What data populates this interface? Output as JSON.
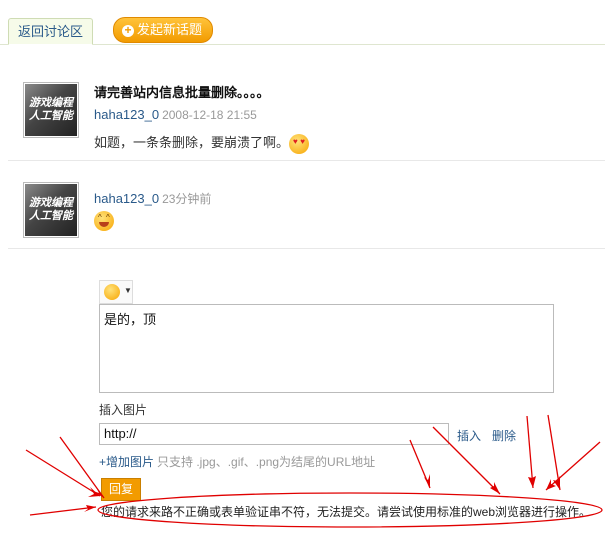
{
  "tabs": {
    "back_label": "返回讨论区",
    "new_topic_label": "发起新话题"
  },
  "posts": [
    {
      "title": "请完善站内信息批量删除。。。。",
      "user": "haha123_0",
      "time": "2008-12-18 21:55",
      "body": "如题，一条条删除，要崩溃了啊。",
      "emoji": "heart-eyes-emoji",
      "avatar_text": [
        "游戏编程",
        "人工智能"
      ]
    },
    {
      "title": "",
      "user": "haha123_0",
      "time": "23分钟前",
      "body": "",
      "emoji": "grin-emoji",
      "avatar_text": [
        "游戏编程",
        "人工智能"
      ]
    }
  ],
  "reply_form": {
    "emoji_picker_icon": "smile-emoji",
    "textarea_value": "是的，顶",
    "insert_image_label": "插入图片",
    "url_value": "http://",
    "insert_link": "插入",
    "delete_link": "删除",
    "add_image_label": "+增加图片",
    "add_image_hint": "只支持 .jpg、.gif、.png为结尾的URL地址",
    "submit_label": "回复"
  },
  "error_message": "您的请求来路不正确或表单验证串不符，无法提交。请尝试使用标准的web浏览器进行操作。",
  "colors": {
    "accent_orange": "#f29b00",
    "link_blue": "#2a5a8a",
    "annotation_red": "#e00000"
  }
}
